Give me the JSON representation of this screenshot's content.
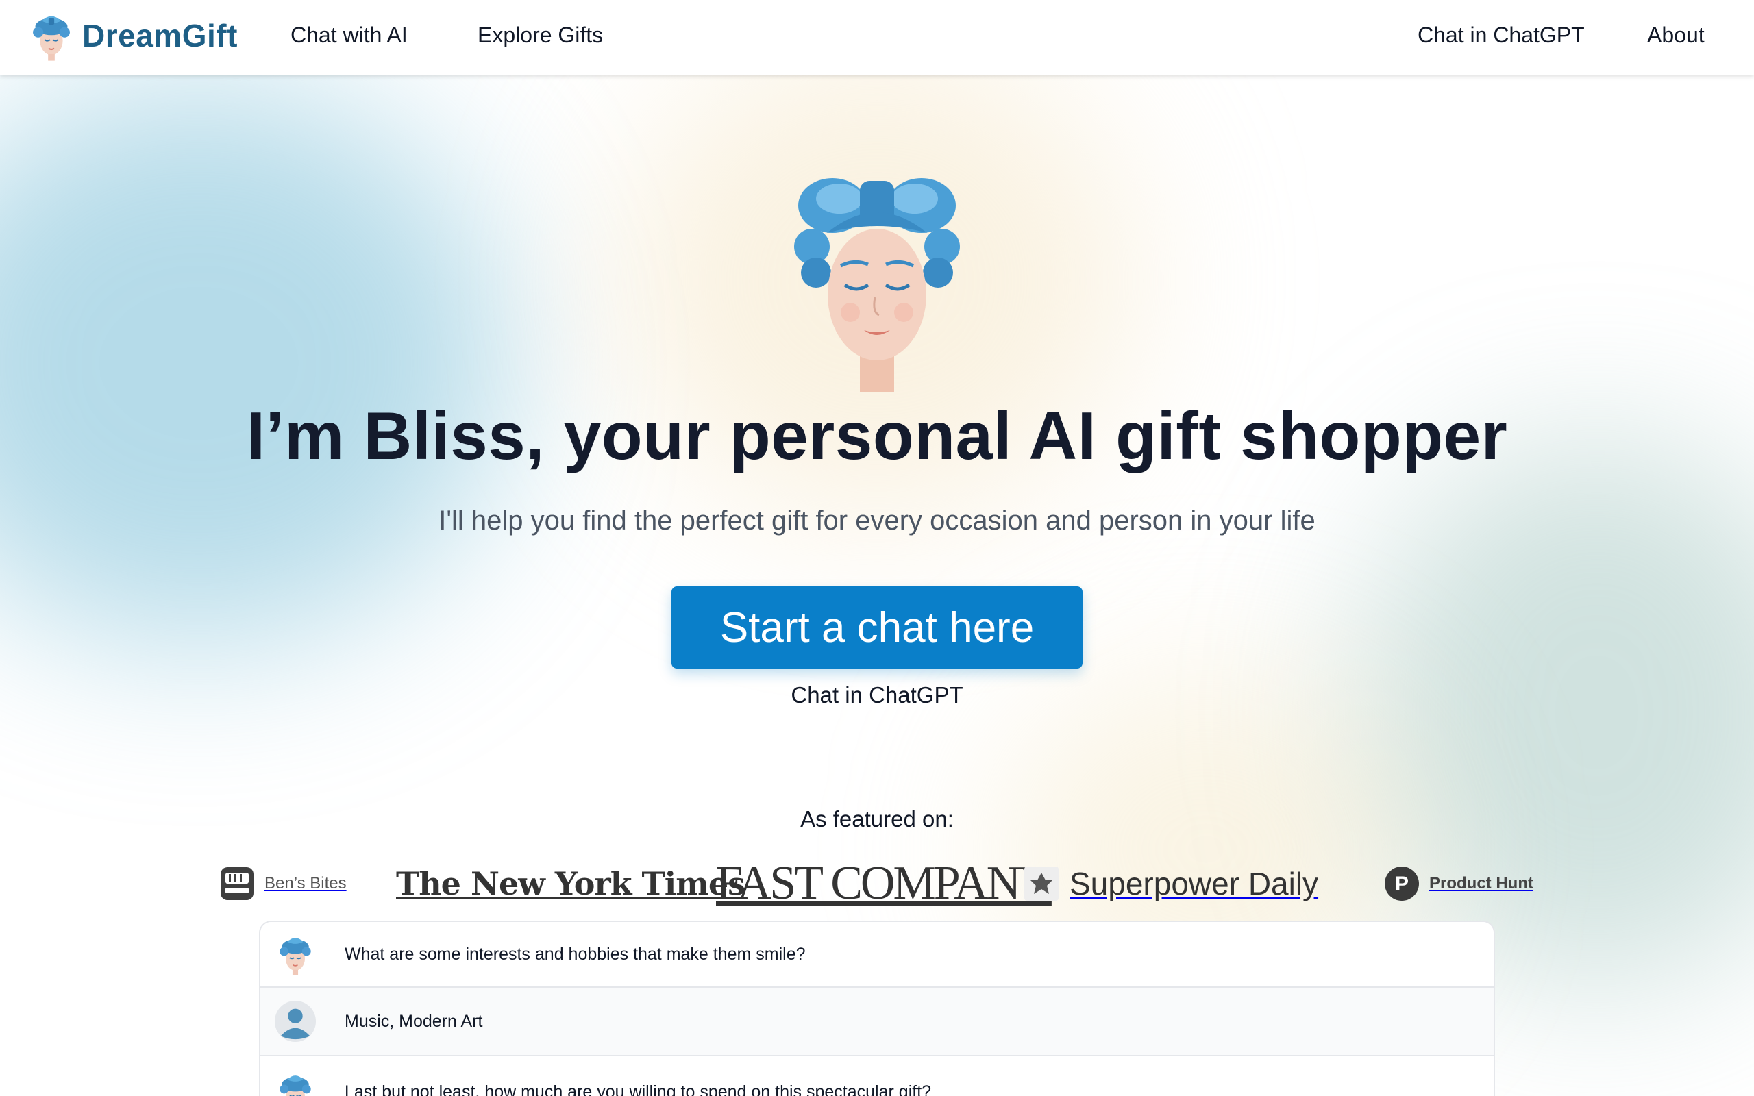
{
  "brand": {
    "name": "DreamGift",
    "icon": "bliss-avatar-icon"
  },
  "nav": {
    "chat_with_ai": "Chat with AI",
    "explore_gifts": "Explore Gifts",
    "chat_in_chatgpt": "Chat in ChatGPT",
    "about": "About"
  },
  "hero": {
    "title": "I’m Bliss, your personal AI gift shopper",
    "subtitle": "I'll help you find the perfect gift for every occasion and person in your life",
    "cta_label": "Start a chat here",
    "cta_secondary": "Chat in ChatGPT"
  },
  "featured": {
    "label": "As featured on:",
    "logos": {
      "bens_bites": "Ben’s Bites",
      "nyt": "The New York Times",
      "fast_company": "FAST COMPANY",
      "superpower": "Superpower Daily",
      "product_hunt": "Product Hunt"
    }
  },
  "chat_preview": {
    "messages": [
      {
        "role": "assistant",
        "text": "What are some interests and hobbies that make them smile?"
      },
      {
        "role": "user",
        "text": "Music, Modern Art"
      },
      {
        "role": "assistant",
        "text": "Last but not least, how much are you willing to spend on this spectacular gift?"
      }
    ]
  },
  "colors": {
    "brand": "#1e5f86",
    "cta": "#0a7fc9",
    "title": "#141b2d",
    "subtitle": "#4b5563"
  }
}
